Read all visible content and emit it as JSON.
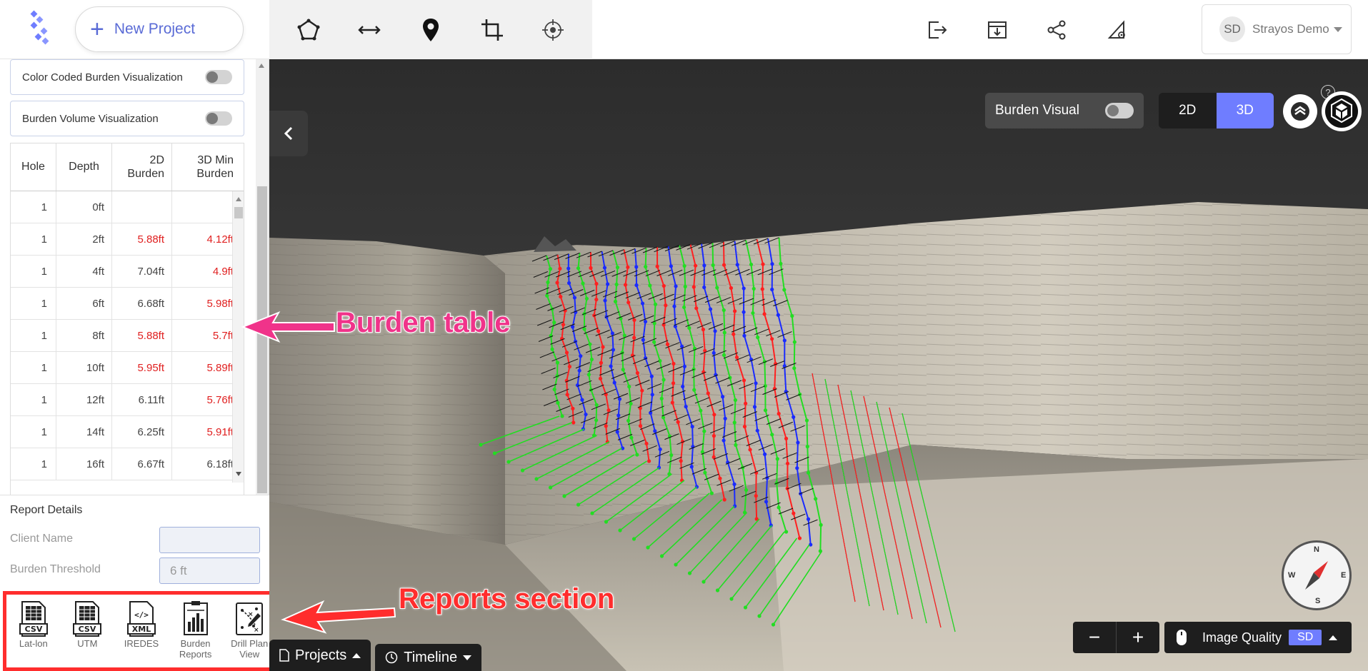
{
  "topbar": {
    "new_project_label": "New Project",
    "tools": [
      "polygon-icon",
      "measure-icon",
      "pin-icon",
      "crop-icon",
      "target-icon"
    ],
    "right_tools": [
      "export-icon",
      "download-icon",
      "share-icon",
      "settings-icon"
    ],
    "user": {
      "initials": "SD",
      "name": "Strayos Demo"
    }
  },
  "sidebar": {
    "toggles": [
      {
        "label": "Color Coded Burden Visualization",
        "on": false
      },
      {
        "label": "Burden Volume Visualization",
        "on": false
      }
    ],
    "table": {
      "headers": {
        "hole": "Hole",
        "depth": "Depth",
        "burden2d": "2D Burden",
        "burden3d": "3D Min Burden"
      },
      "rows": [
        {
          "hole": "1",
          "depth": "0ft",
          "b2": "",
          "b3": "",
          "r2": false,
          "r3": false
        },
        {
          "hole": "1",
          "depth": "2ft",
          "b2": "5.88ft",
          "b3": "4.12ft",
          "r2": true,
          "r3": true
        },
        {
          "hole": "1",
          "depth": "4ft",
          "b2": "7.04ft",
          "b3": "4.9ft",
          "r2": false,
          "r3": true
        },
        {
          "hole": "1",
          "depth": "6ft",
          "b2": "6.68ft",
          "b3": "5.98ft",
          "r2": false,
          "r3": true
        },
        {
          "hole": "1",
          "depth": "8ft",
          "b2": "5.88ft",
          "b3": "5.7ft",
          "r2": true,
          "r3": true
        },
        {
          "hole": "1",
          "depth": "10ft",
          "b2": "5.95ft",
          "b3": "5.89ft",
          "r2": true,
          "r3": true
        },
        {
          "hole": "1",
          "depth": "12ft",
          "b2": "6.11ft",
          "b3": "5.76ft",
          "r2": false,
          "r3": true
        },
        {
          "hole": "1",
          "depth": "14ft",
          "b2": "6.25ft",
          "b3": "5.91ft",
          "r2": false,
          "r3": true
        },
        {
          "hole": "1",
          "depth": "16ft",
          "b2": "6.67ft",
          "b3": "6.18ft",
          "r2": false,
          "r3": false
        }
      ]
    },
    "report_details": {
      "title": "Report Details",
      "client_name_label": "Client Name",
      "client_name_value": "",
      "burden_threshold_label": "Burden Threshold",
      "burden_threshold_value": "6 ft"
    },
    "reports": [
      {
        "label": "Lat-lon",
        "icon": "csv-file-icon",
        "tag": "CSV"
      },
      {
        "label": "UTM",
        "icon": "csv-file-icon",
        "tag": "CSV"
      },
      {
        "label": "IREDES",
        "icon": "xml-file-icon",
        "tag": "XML"
      },
      {
        "label": "Burden Reports",
        "icon": "bar-report-icon",
        "tag": ""
      },
      {
        "label": "Drill Plan View",
        "icon": "drill-plan-icon",
        "tag": ""
      }
    ]
  },
  "viewport": {
    "burden_visual_label": "Burden Visual",
    "view_2d": "2D",
    "view_3d": "3D",
    "active_view": "3D",
    "help": "?",
    "compass": {
      "n": "N",
      "s": "S",
      "e": "E",
      "w": "W"
    },
    "tabs": {
      "projects": "Projects",
      "timeline": "Timeline"
    },
    "zoom_out": "−",
    "zoom_in": "+",
    "image_quality_label": "Image Quality",
    "image_quality_value": "SD"
  },
  "annotations": {
    "burden_table": "Burden table",
    "reports_section": "Reports section"
  },
  "colors": {
    "accent": "#6f7dff",
    "annotation_pink": "#f0338a",
    "annotation_red": "#ff2d2d",
    "burden_red": "#e02020"
  }
}
